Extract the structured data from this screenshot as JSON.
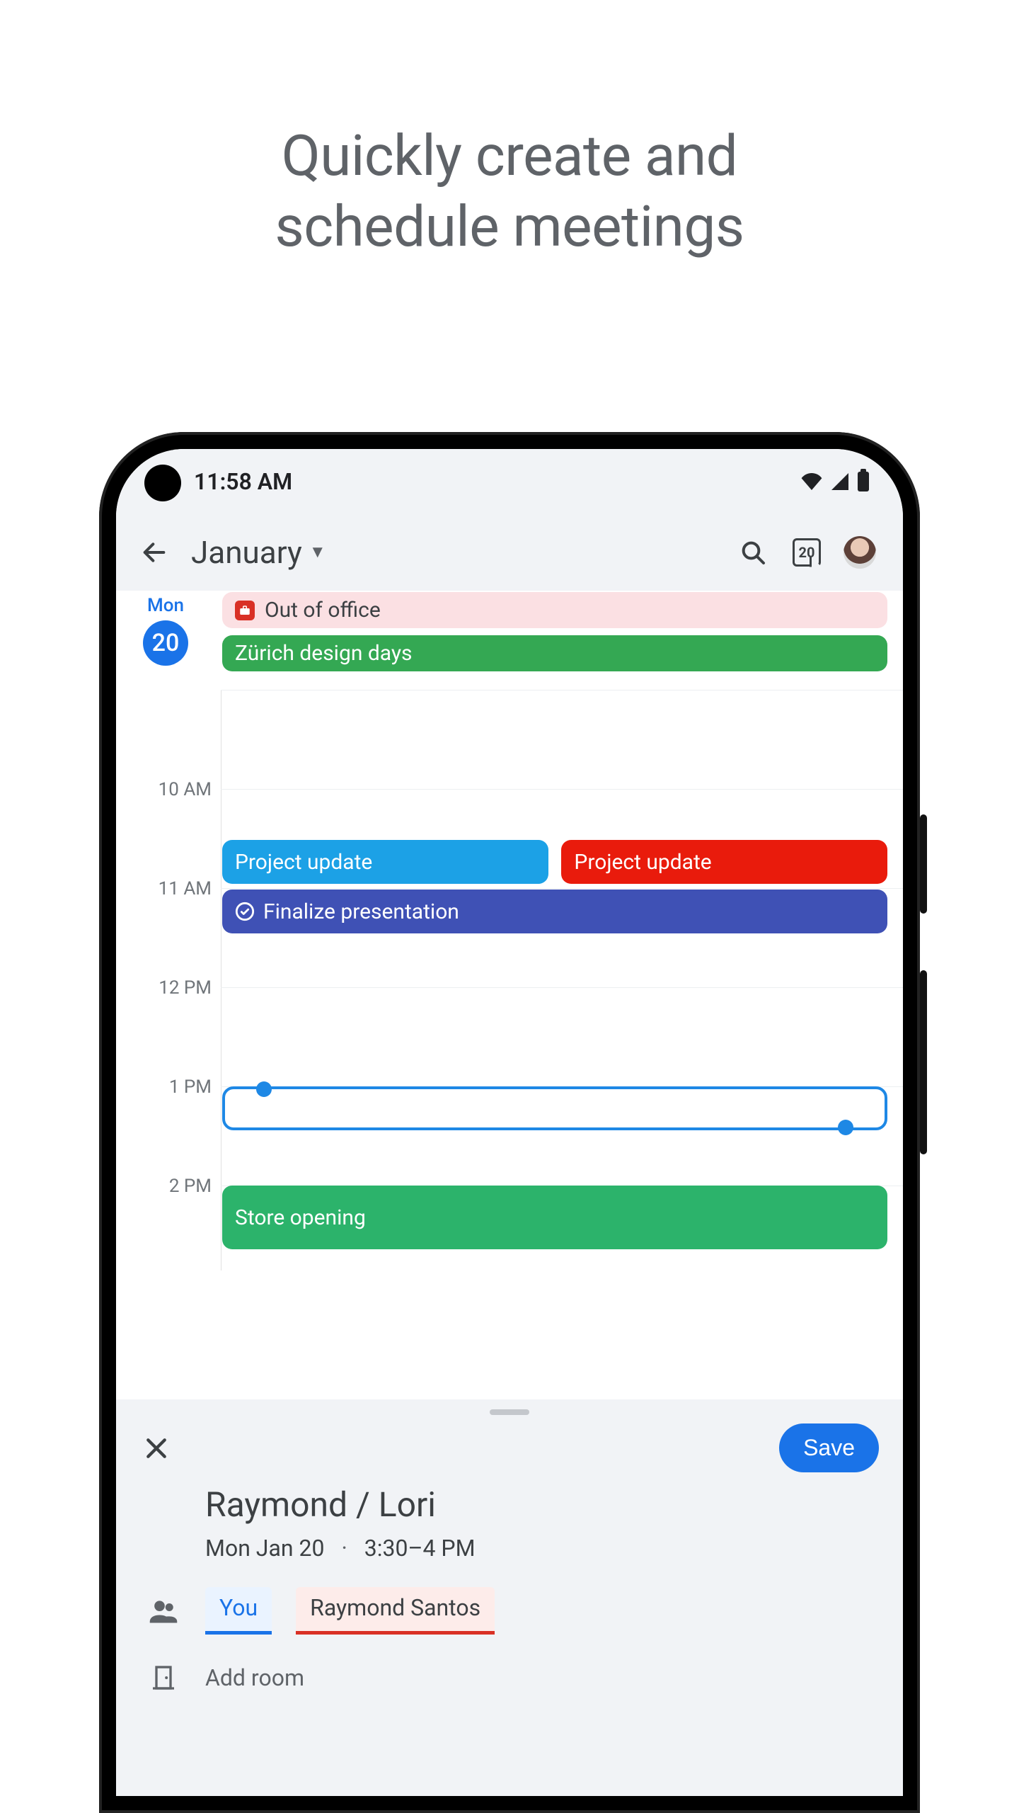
{
  "headline_line1": "Quickly create and",
  "headline_line2": "schedule meetings",
  "status": {
    "time": "11:58 AM"
  },
  "header": {
    "month": "January",
    "today_number": "20"
  },
  "day": {
    "weekday": "Mon",
    "number": "20"
  },
  "allday": [
    {
      "title": "Out of office",
      "style": "pink",
      "icon": "ooo"
    },
    {
      "title": "Zürich design days",
      "style": "green"
    }
  ],
  "hours": [
    "10 AM",
    "11 AM",
    "12 PM",
    "1 PM",
    "2 PM"
  ],
  "events": {
    "project_update_1": "Project update",
    "project_update_2": "Project update",
    "finalize": "Finalize presentation",
    "store": "Store opening"
  },
  "sheet": {
    "save_label": "Save",
    "title": "Raymond / Lori",
    "date": "Mon Jan 20",
    "time": "3:30–4 PM",
    "chip_you": "You",
    "chip_raymond": "Raymond Santos",
    "add_room": "Add room"
  }
}
